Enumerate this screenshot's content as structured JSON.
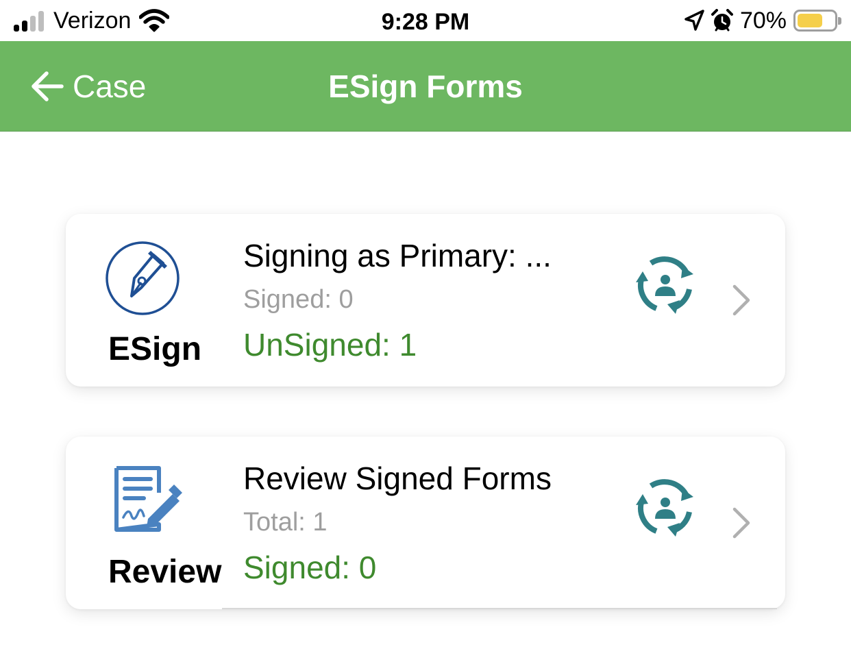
{
  "status_bar": {
    "carrier": "Verizon",
    "time": "9:28 PM",
    "battery_percent": "70%",
    "battery_level": 0.7,
    "icons": [
      "signal-icon",
      "wifi-icon",
      "location-icon",
      "alarm-icon",
      "battery-icon"
    ]
  },
  "nav": {
    "back_label": "Case",
    "title": "ESign Forms",
    "bar_color": "#6db761"
  },
  "cards": [
    {
      "label": "ESign",
      "title": "Signing as Primary: ...",
      "sub": "Signed: 0",
      "status": "UnSigned: 1",
      "icon": "pen-nib-icon"
    },
    {
      "label": "Review",
      "title": "Review Signed Forms",
      "sub": "Total: 1",
      "status": "Signed: 0",
      "icon": "signed-document-icon"
    }
  ],
  "colors": {
    "accent_green": "#3f8a2e",
    "sync_teal": "#2f7f86",
    "esign_blue": "#1f4f94",
    "review_blue": "#4a82c0"
  }
}
